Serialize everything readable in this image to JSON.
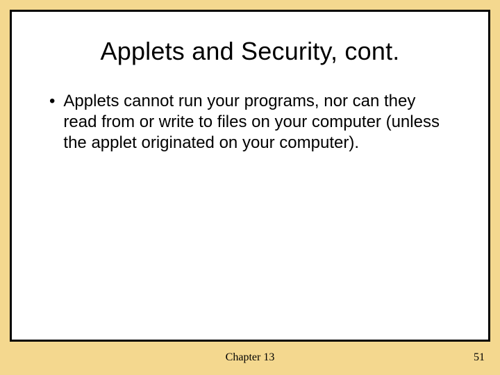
{
  "slide": {
    "title": "Applets and Security, cont.",
    "bullet": {
      "marker": "•",
      "text": "Applets cannot run your programs, nor can they read from or write to files on your computer (unless the applet originated on your computer)."
    }
  },
  "footer": {
    "center": "Chapter 13",
    "page": "51"
  }
}
